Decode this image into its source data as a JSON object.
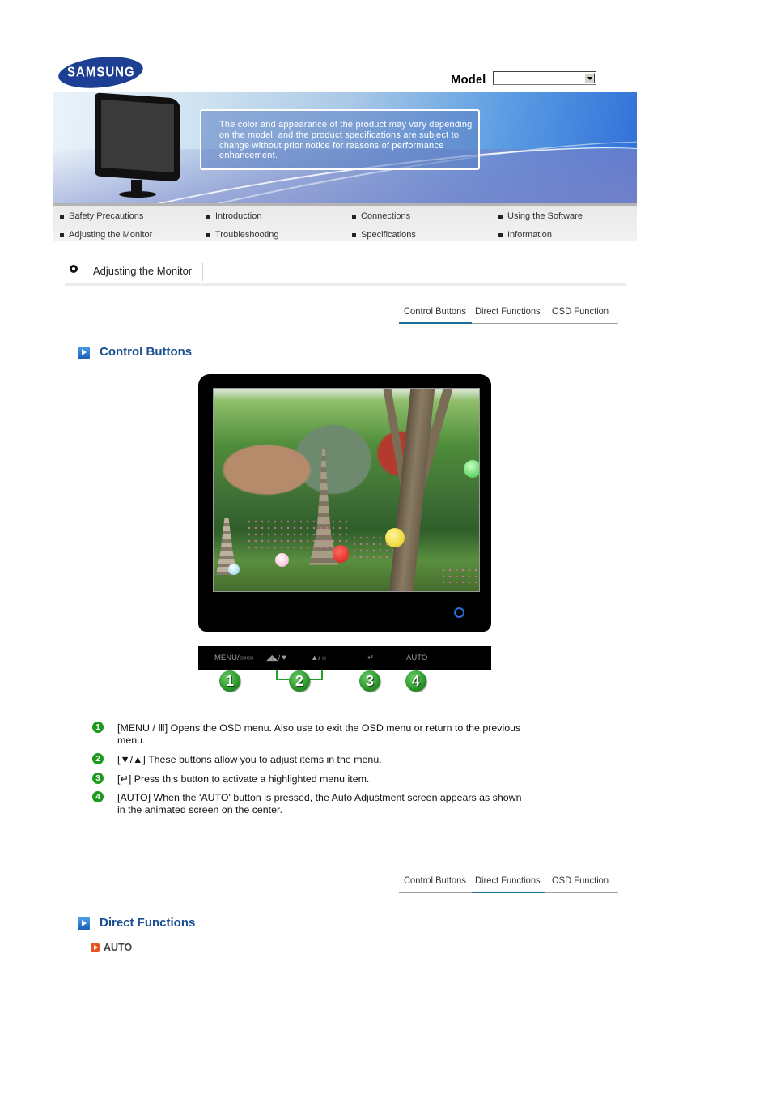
{
  "header": {
    "brand": "SAMSUNG",
    "model_label": "Model",
    "model_select_value": ""
  },
  "banner": {
    "notice": "The color and appearance of the product may vary depending on the model, and the product specifications are subject to change without prior notice for reasons of performance enhancement."
  },
  "nav": {
    "items": [
      {
        "label": "Safety Precautions"
      },
      {
        "label": "Introduction"
      },
      {
        "label": "Connections"
      },
      {
        "label": "Using the Software"
      },
      {
        "label": "Adjusting the Monitor"
      },
      {
        "label": "Troubleshooting"
      },
      {
        "label": "Specifications"
      },
      {
        "label": "Information"
      }
    ]
  },
  "breadcrumb": {
    "title": "Adjusting the Monitor"
  },
  "tabs": {
    "items": [
      {
        "label": "Control Buttons"
      },
      {
        "label": "Direct Functions"
      },
      {
        "label": "OSD Function"
      }
    ],
    "active_top": "Control Buttons",
    "active_bottom": "Direct Functions"
  },
  "control_buttons": {
    "title": "Control Buttons",
    "strip_labels": [
      "MENU/▭▭",
      "◢◣/▼",
      "▲/☼",
      "↵",
      "AUTO"
    ],
    "numbers": [
      "1",
      "2",
      "3",
      "4"
    ],
    "descriptions": [
      {
        "num": "1",
        "text": "[MENU / Ⅲ] Opens the OSD menu. Also use to exit the OSD menu or return to the previous menu."
      },
      {
        "num": "2",
        "text": "[▼/▲] These buttons allow you to adjust items in the menu."
      },
      {
        "num": "3",
        "text": "[↵] Press this button to activate a highlighted menu item."
      },
      {
        "num": "4",
        "text": "[AUTO] When the 'AUTO' button is pressed, the Auto Adjustment screen appears as shown in the animated screen on the center."
      }
    ]
  },
  "direct_functions": {
    "title": "Direct Functions",
    "items": [
      {
        "label": "AUTO"
      }
    ]
  },
  "colors": {
    "section_title": "#1a4f8f",
    "tab_active_underline": "#1d6e94",
    "number_badge": "#1c9a1c",
    "sub_item_icon": "#e5561f",
    "logo": "#1c3f94"
  }
}
